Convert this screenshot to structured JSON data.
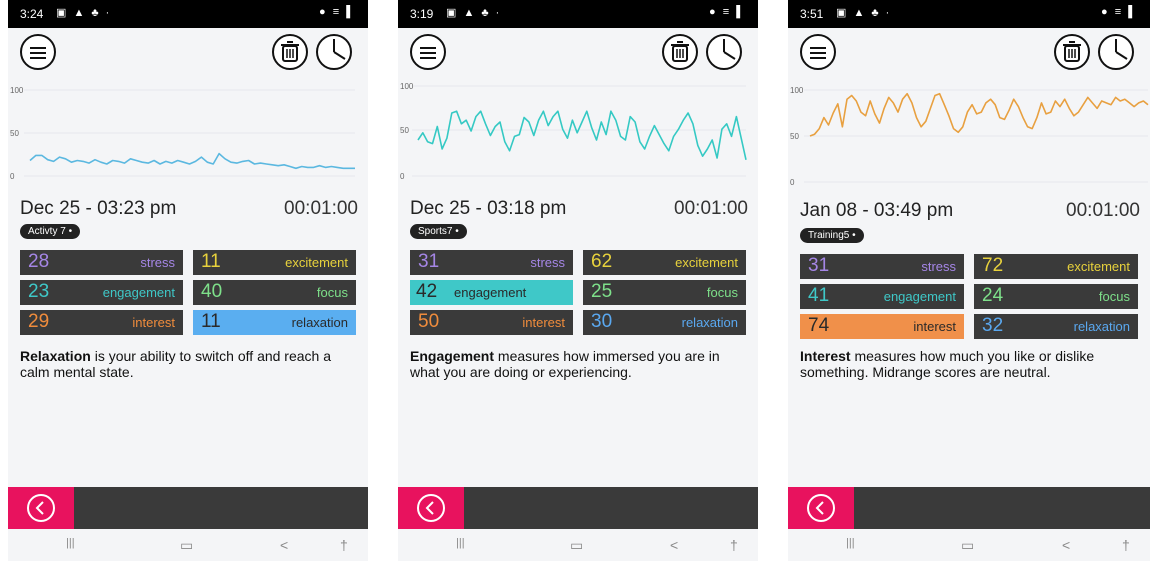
{
  "panels": [
    {
      "status": {
        "time": "3:24"
      },
      "chart_data": {
        "type": "line",
        "yticks": [
          "100",
          "50",
          "0"
        ],
        "ylim": [
          0,
          100
        ],
        "color": "#5bb8e0",
        "values": [
          18,
          24,
          24,
          19,
          17,
          22,
          20,
          16,
          18,
          17,
          15,
          19,
          16,
          14,
          18,
          17,
          15,
          20,
          18,
          16,
          15,
          18,
          14,
          17,
          15,
          18,
          16,
          14,
          17,
          22,
          16,
          14,
          26,
          20,
          16,
          15,
          17,
          18,
          14,
          15,
          14,
          13,
          12,
          13,
          11,
          9,
          11,
          10,
          10,
          12,
          10,
          11,
          10,
          9,
          9,
          9
        ]
      },
      "session": {
        "date": "Dec 25 - 03:23 pm",
        "duration": "00:01:00",
        "tag": "Activty 7"
      },
      "metrics": [
        {
          "value": "28",
          "label": "stress"
        },
        {
          "value": "11",
          "label": "excitement"
        },
        {
          "value": "23",
          "label": "engagement"
        },
        {
          "value": "40",
          "label": "focus"
        },
        {
          "value": "29",
          "label": "interest"
        },
        {
          "value": "11",
          "label": "relaxation"
        }
      ],
      "selected_metric": "relaxation",
      "description": {
        "bold": "Relaxation",
        "rest": " is your ability to switch off and reach a calm mental state."
      }
    },
    {
      "status": {
        "time": "3:19"
      },
      "chart_data": {
        "type": "line",
        "yticks": [
          "100",
          "50",
          "0"
        ],
        "ylim": [
          0,
          100
        ],
        "color": "#35c9c4",
        "values": [
          40,
          48,
          38,
          36,
          55,
          30,
          42,
          70,
          72,
          58,
          62,
          50,
          66,
          72,
          58,
          45,
          55,
          60,
          38,
          28,
          44,
          46,
          65,
          60,
          45,
          62,
          72,
          56,
          66,
          72,
          52,
          42,
          62,
          48,
          60,
          72,
          54,
          40,
          60,
          46,
          72,
          62,
          44,
          40,
          66,
          60,
          38,
          30,
          44,
          56,
          46,
          36,
          28,
          44,
          52,
          62,
          70,
          58,
          34,
          22,
          30,
          40,
          20,
          52,
          58,
          44,
          66,
          42,
          18
        ]
      },
      "session": {
        "date": "Dec 25 - 03:18 pm",
        "duration": "00:01:00",
        "tag": "Sports7"
      },
      "metrics": [
        {
          "value": "31",
          "label": "stress"
        },
        {
          "value": "62",
          "label": "excitement"
        },
        {
          "value": "42",
          "label": "engagement"
        },
        {
          "value": "25",
          "label": "focus"
        },
        {
          "value": "50",
          "label": "interest"
        },
        {
          "value": "30",
          "label": "relaxation"
        }
      ],
      "selected_metric": "engagement",
      "description": {
        "bold": "Engagement",
        "rest": " measures how immersed you are in what you are doing or experiencing."
      }
    },
    {
      "status": {
        "time": "3:51"
      },
      "chart_data": {
        "type": "line",
        "yticks": [
          "100",
          "50",
          "0"
        ],
        "ylim": [
          0,
          100
        ],
        "color": "#e8a040",
        "values": [
          50,
          52,
          58,
          70,
          62,
          75,
          85,
          60,
          90,
          94,
          88,
          76,
          72,
          88,
          74,
          64,
          80,
          92,
          86,
          76,
          90,
          96,
          86,
          70,
          60,
          66,
          80,
          94,
          96,
          84,
          72,
          58,
          54,
          60,
          76,
          84,
          74,
          76,
          86,
          90,
          84,
          70,
          68,
          78,
          90,
          82,
          70,
          60,
          58,
          70,
          86,
          74,
          76,
          88,
          82,
          90,
          80,
          72,
          76,
          84,
          92,
          86,
          80,
          88,
          86,
          84,
          92,
          88,
          90,
          86,
          82,
          86,
          88,
          84
        ]
      },
      "session": {
        "date": "Jan 08 - 03:49 pm",
        "duration": "00:01:00",
        "tag": "Training5"
      },
      "metrics": [
        {
          "value": "31",
          "label": "stress"
        },
        {
          "value": "72",
          "label": "excitement"
        },
        {
          "value": "41",
          "label": "engagement"
        },
        {
          "value": "24",
          "label": "focus"
        },
        {
          "value": "74",
          "label": "interest"
        },
        {
          "value": "32",
          "label": "relaxation"
        }
      ],
      "selected_metric": "interest",
      "description": {
        "bold": "Interest",
        "rest": " measures how much you like or dislike something. Midrange scores are neutral."
      }
    }
  ],
  "metric_colors": {
    "stress": "#a586e6",
    "excitement": "#e8d23c",
    "engagement": "#3fc8c8",
    "focus": "#7ee08a",
    "interest": "#f08c3c",
    "relaxation": "#5aa8f0"
  },
  "selected_colors": {
    "engagement": "#3fc8c8",
    "interest": "#f0904a",
    "relaxation": "#5aaef0"
  },
  "icons": [
    "menu-icon",
    "trash-icon",
    "history-pie-icon",
    "back-chevron-icon"
  ]
}
